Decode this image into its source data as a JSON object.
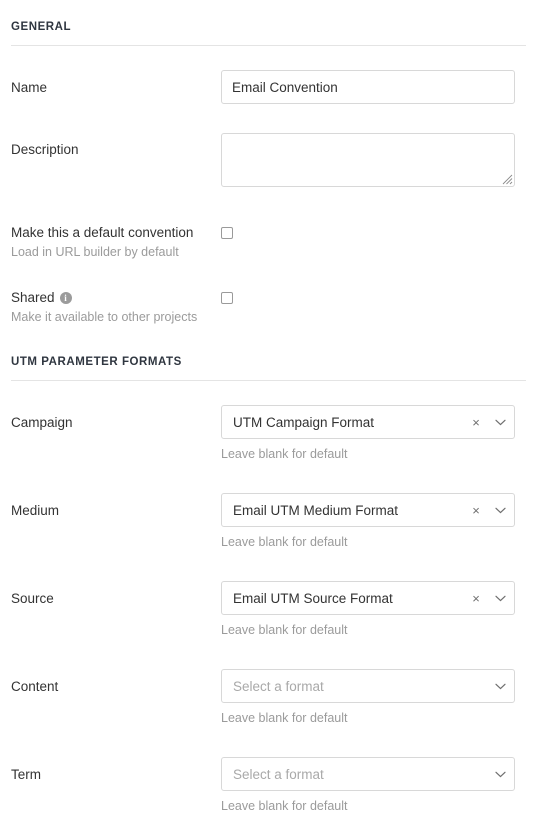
{
  "sections": {
    "general": {
      "title": "GENERAL",
      "name": {
        "label": "Name",
        "value": "Email Convention",
        "placeholder": ""
      },
      "description": {
        "label": "Description",
        "value": "",
        "placeholder": ""
      },
      "default_convention": {
        "label": "Make this a default convention",
        "help": "Load in URL builder by default",
        "checked": false
      },
      "shared": {
        "label": "Shared",
        "help": "Make it available to other projects",
        "checked": false,
        "info_glyph": "i"
      }
    },
    "utm": {
      "title": "UTM PARAMETER FORMATS",
      "helper": "Leave blank for default",
      "placeholder": "Select a format",
      "clear_glyph": "×",
      "fields": [
        {
          "label": "Campaign",
          "value": "UTM Campaign Format",
          "has_value": true
        },
        {
          "label": "Medium",
          "value": "Email UTM Medium Format",
          "has_value": true
        },
        {
          "label": "Source",
          "value": "Email UTM Source Format",
          "has_value": true
        },
        {
          "label": "Content",
          "value": "",
          "has_value": false
        },
        {
          "label": "Term",
          "value": "",
          "has_value": false
        }
      ]
    }
  },
  "colors": {
    "text": "#333333",
    "muted": "#9b9b9b",
    "border": "#d8d8d8",
    "rule": "#e4e4e4",
    "heading": "#2f3640"
  }
}
